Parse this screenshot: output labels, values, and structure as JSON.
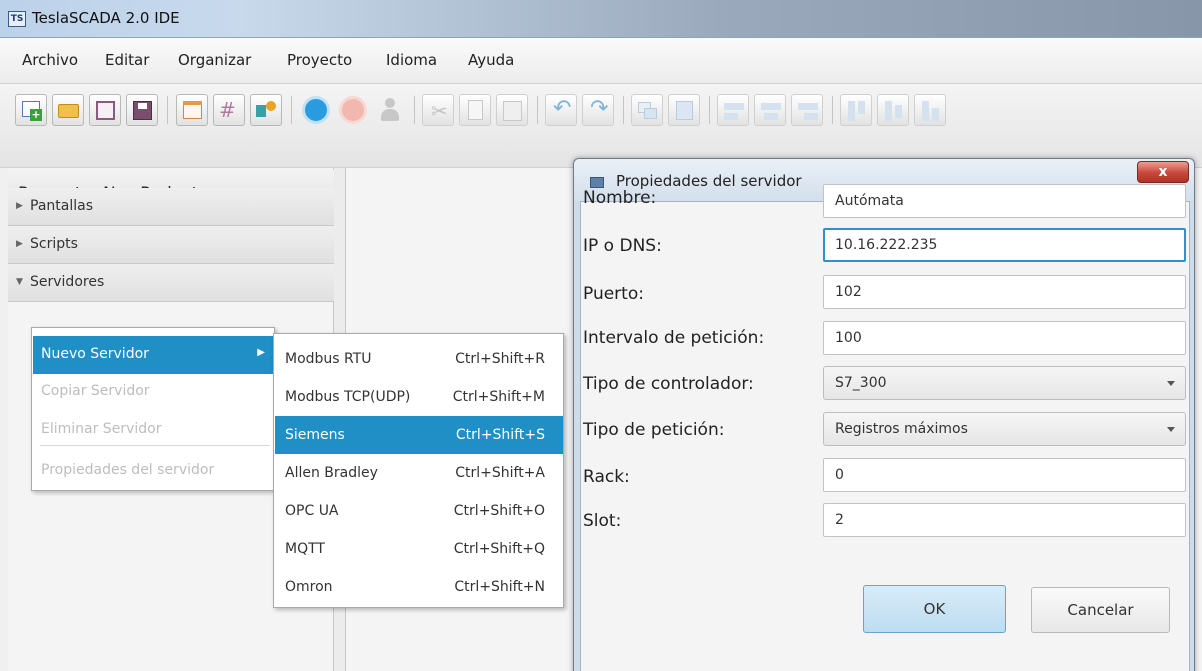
{
  "window": {
    "app_icon_text": "TS",
    "title": "TeslaSCADA 2.0 IDE"
  },
  "menubar": {
    "items": [
      "Archivo",
      "Editar",
      "Organizar",
      "Proyecto",
      "Idioma",
      "Ayuda"
    ]
  },
  "toolbar": {
    "buttons": [
      {
        "icon": "new-icon"
      },
      {
        "icon": "open-folder-icon"
      },
      {
        "icon": "save-icon"
      },
      {
        "icon": "save-as-icon"
      },
      {
        "icon": "window-icon"
      },
      {
        "icon": "grid-icon"
      },
      {
        "icon": "component-icon"
      },
      {
        "icon": "run-icon"
      },
      {
        "icon": "stop-icon"
      },
      {
        "icon": "user-icon"
      },
      {
        "icon": "cut-icon"
      },
      {
        "icon": "copy-icon"
      },
      {
        "icon": "paste-icon"
      },
      {
        "icon": "undo-icon"
      },
      {
        "icon": "redo-icon"
      },
      {
        "icon": "bring-front-icon"
      },
      {
        "icon": "send-back-icon"
      },
      {
        "icon": "align-left-icon"
      },
      {
        "icon": "align-center-icon"
      },
      {
        "icon": "align-right-icon"
      },
      {
        "icon": "align-top-icon"
      },
      {
        "icon": "align-middle-icon"
      },
      {
        "icon": "align-bottom-icon"
      }
    ]
  },
  "project_panel": {
    "title": "Proyecto: NewProject",
    "sections": [
      {
        "label": "Pantallas",
        "expanded": false
      },
      {
        "label": "Scripts",
        "expanded": false
      },
      {
        "label": "Servidores",
        "expanded": true
      }
    ]
  },
  "context_menu": {
    "items": [
      {
        "label": "Nuevo Servidor",
        "enabled": true,
        "active": true,
        "has_submenu": true
      },
      {
        "label": "Copiar Servidor",
        "enabled": false
      },
      {
        "label": "Eliminar Servidor",
        "enabled": false
      },
      {
        "label": "Propiedades del servidor",
        "enabled": false
      }
    ]
  },
  "submenu": {
    "items": [
      {
        "label": "Modbus RTU",
        "shortcut": "Ctrl+Shift+R"
      },
      {
        "label": "Modbus TCP(UDP)",
        "shortcut": "Ctrl+Shift+M"
      },
      {
        "label": "Siemens",
        "shortcut": "Ctrl+Shift+S",
        "active": true
      },
      {
        "label": "Allen Bradley",
        "shortcut": "Ctrl+Shift+A"
      },
      {
        "label": "OPC UA",
        "shortcut": "Ctrl+Shift+O"
      },
      {
        "label": "MQTT",
        "shortcut": "Ctrl+Shift+Q"
      },
      {
        "label": "Omron",
        "shortcut": "Ctrl+Shift+N"
      }
    ]
  },
  "dialog": {
    "title": "Propiedades del servidor",
    "close_label": "x",
    "fields": [
      {
        "label": "Nombre:",
        "value": "Autómata",
        "type": "text"
      },
      {
        "label": "IP o DNS:",
        "value": "10.16.222.235",
        "type": "text",
        "focused": true
      },
      {
        "label": "Puerto:",
        "value": "102",
        "type": "text"
      },
      {
        "label": "Intervalo de petición:",
        "value": "100",
        "type": "text"
      },
      {
        "label": "Tipo de controlador:",
        "value": "S7_300",
        "type": "select"
      },
      {
        "label": "Tipo de petición:",
        "value": "Registros máximos",
        "type": "select"
      },
      {
        "label": "Rack:",
        "value": "0",
        "type": "text"
      },
      {
        "label": "Slot:",
        "value": "2",
        "type": "text"
      }
    ],
    "ok_label": "OK",
    "cancel_label": "Cancelar"
  }
}
